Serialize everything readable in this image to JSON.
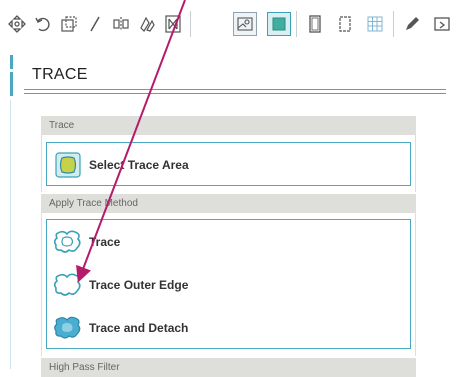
{
  "panel": {
    "title": "TRACE"
  },
  "sections": {
    "trace": {
      "header": "Trace",
      "select_label": "Select Trace Area"
    },
    "method": {
      "header": "Apply Trace Method",
      "trace_label": "Trace",
      "outer_edge_label": "Trace Outer Edge",
      "detach_label": "Trace and Detach"
    },
    "filter": {
      "header": "High Pass Filter"
    }
  },
  "toolbar": {
    "icons": [
      "move-icon",
      "rotate-icon",
      "scale-icon",
      "shear-icon",
      "mirror-icon",
      "replicate-icon",
      "nest-icon",
      "image-icon",
      "trace-icon",
      "page-icon",
      "cut-border-icon",
      "grid-icon",
      "pen-icon",
      "send-icon"
    ],
    "active": "trace-icon"
  },
  "colors": {
    "accent": "#4aa9c2",
    "header_bg": "#dededb",
    "annotation_arrow": "#b51b6b"
  }
}
